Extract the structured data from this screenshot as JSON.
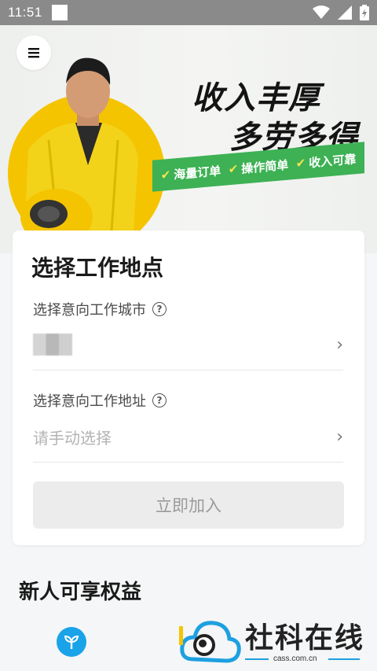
{
  "status_bar": {
    "time": "11:51"
  },
  "banner": {
    "slogan_line1": "收入丰厚",
    "slogan_line2": "多劳多得",
    "tags": [
      "海量订单",
      "操作简单",
      "收入可靠"
    ]
  },
  "form": {
    "title": "选择工作地点",
    "city_label": "选择意向工作城市",
    "address_label": "选择意向工作地址",
    "address_placeholder": "请手动选择",
    "submit_label": "立即加入"
  },
  "benefits": {
    "title": "新人可享权益"
  },
  "watermark": {
    "text": "社科在线",
    "url": "cass.com.cn"
  },
  "colors": {
    "accent_green": "#3db154",
    "brand_yellow": "#f5c400",
    "benefit_blue": "#1aa3e8"
  }
}
